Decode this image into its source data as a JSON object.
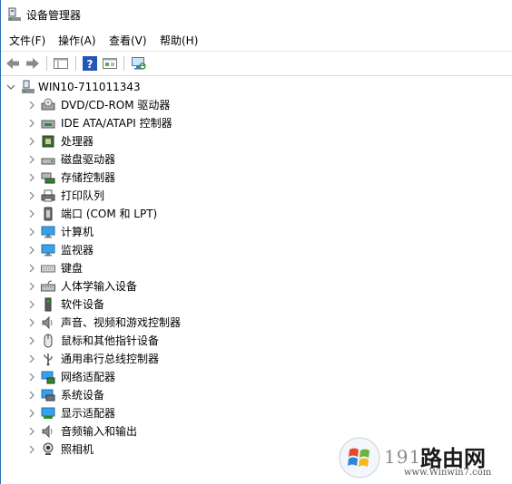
{
  "window": {
    "title": "设备管理器"
  },
  "menu": [
    {
      "label": "文件(F)"
    },
    {
      "label": "操作(A)"
    },
    {
      "label": "查看(V)"
    },
    {
      "label": "帮助(H)"
    }
  ],
  "toolbar": {
    "buttons": [
      "back-icon",
      "forward-icon",
      "show-hide-tree-icon",
      "help-icon",
      "properties-icon",
      "scan-hardware-icon"
    ]
  },
  "tree": {
    "root": {
      "label": "WIN10-711011343",
      "expanded": true
    },
    "categories": [
      {
        "label": "DVD/CD-ROM 驱动器",
        "icon": "dvd-drive-icon"
      },
      {
        "label": "IDE ATA/ATAPI 控制器",
        "icon": "ide-controller-icon"
      },
      {
        "label": "处理器",
        "icon": "processor-icon"
      },
      {
        "label": "磁盘驱动器",
        "icon": "disk-drive-icon"
      },
      {
        "label": "存储控制器",
        "icon": "storage-controller-icon"
      },
      {
        "label": "打印队列",
        "icon": "printer-icon"
      },
      {
        "label": "端口 (COM 和 LPT)",
        "icon": "port-icon"
      },
      {
        "label": "计算机",
        "icon": "computer-icon"
      },
      {
        "label": "监视器",
        "icon": "monitor-icon"
      },
      {
        "label": "键盘",
        "icon": "keyboard-icon"
      },
      {
        "label": "人体学输入设备",
        "icon": "hid-icon"
      },
      {
        "label": "软件设备",
        "icon": "software-device-icon"
      },
      {
        "label": "声音、视频和游戏控制器",
        "icon": "speaker-icon"
      },
      {
        "label": "鼠标和其他指针设备",
        "icon": "mouse-icon"
      },
      {
        "label": "通用串行总线控制器",
        "icon": "usb-icon"
      },
      {
        "label": "网络适配器",
        "icon": "network-adapter-icon"
      },
      {
        "label": "系统设备",
        "icon": "system-device-icon"
      },
      {
        "label": "显示适配器",
        "icon": "display-adapter-icon"
      },
      {
        "label": "音频输入和输出",
        "icon": "audio-io-icon"
      },
      {
        "label": "照相机",
        "icon": "camera-icon"
      }
    ]
  },
  "watermark": {
    "number": "191",
    "brand": "路由网",
    "url": "www.Winwin7.com"
  },
  "colors": {
    "accent": "#2b6fb6",
    "chevron": "#808080"
  }
}
